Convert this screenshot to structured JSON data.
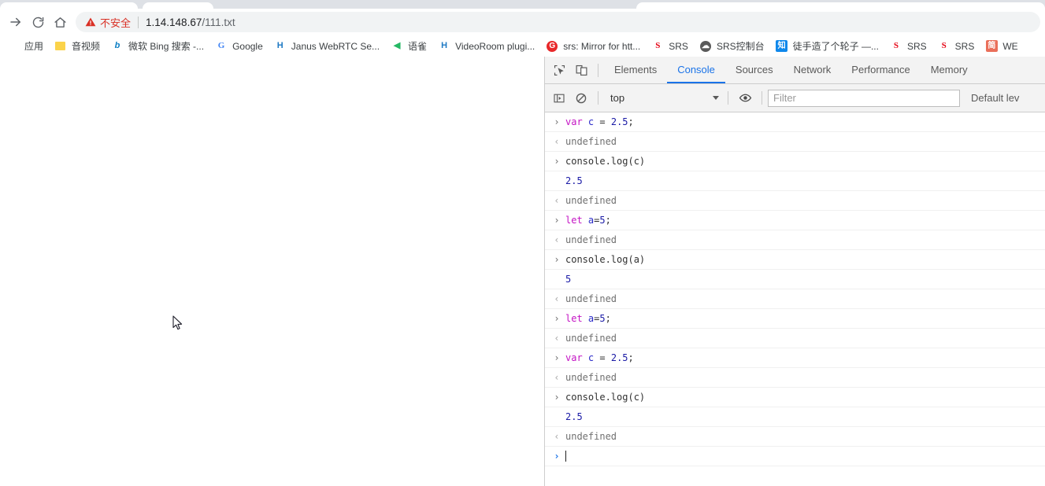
{
  "browser": {
    "nav": {
      "forward_icon": "arrow-right-icon",
      "reload_icon": "reload-icon",
      "home_icon": "home-icon"
    },
    "omnibox": {
      "security_icon": "warning-triangle-icon",
      "security_label": "不安全",
      "url_host": "1.14.148.67",
      "url_path": "/111.txt"
    },
    "bookmarks": [
      {
        "icon": "apps-icon",
        "label": "应用"
      },
      {
        "icon": "folder-icon",
        "label": "音视频"
      },
      {
        "icon": "bing-icon",
        "label": "微软 Bing 搜索 -..."
      },
      {
        "icon": "google-icon",
        "label": "Google"
      },
      {
        "icon": "janus-icon",
        "label": "Janus WebRTC Se..."
      },
      {
        "icon": "yuque-icon",
        "label": "语雀"
      },
      {
        "icon": "janus-icon",
        "label": "VideoRoom plugi..."
      },
      {
        "icon": "srs-github-icon",
        "label": "srs: Mirror for htt..."
      },
      {
        "icon": "srs-icon",
        "label": "SRS"
      },
      {
        "icon": "globe-icon",
        "label": "SRS控制台"
      },
      {
        "icon": "zhihu-icon",
        "label": "徒手造了个轮子 —..."
      },
      {
        "icon": "srs-icon",
        "label": "SRS"
      },
      {
        "icon": "srs-icon",
        "label": "SRS"
      },
      {
        "icon": "jianshu-icon",
        "label": "WE"
      }
    ]
  },
  "devtools": {
    "inspect_icon": "inspect-element-icon",
    "device_icon": "device-toolbar-icon",
    "tabs": [
      {
        "label": "Elements",
        "active": false
      },
      {
        "label": "Console",
        "active": true
      },
      {
        "label": "Sources",
        "active": false
      },
      {
        "label": "Network",
        "active": false
      },
      {
        "label": "Performance",
        "active": false
      },
      {
        "label": "Memory",
        "active": false
      }
    ],
    "toolbar": {
      "sidebar_icon": "console-sidebar-icon",
      "clear_icon": "clear-console-icon",
      "context_value": "top",
      "eye_icon": "live-expression-icon",
      "filter_placeholder": "Filter",
      "filter_value": "",
      "level_label": "Default lev"
    },
    "console_rows": [
      {
        "gutter": "input",
        "kind": "code",
        "tokens": [
          {
            "t": "var",
            "c": "kw"
          },
          {
            "t": " ",
            "c": "op"
          },
          {
            "t": "c",
            "c": "var"
          },
          {
            "t": " = ",
            "c": "op"
          },
          {
            "t": "2.5",
            "c": "num"
          },
          {
            "t": ";",
            "c": "op"
          }
        ]
      },
      {
        "gutter": "output",
        "kind": "undefined",
        "text": "undefined"
      },
      {
        "gutter": "input",
        "kind": "code",
        "tokens": [
          {
            "t": "console.log(c)",
            "c": "op"
          }
        ]
      },
      {
        "gutter": "none",
        "kind": "value",
        "text": "2.5"
      },
      {
        "gutter": "output",
        "kind": "undefined",
        "text": "undefined"
      },
      {
        "gutter": "input",
        "kind": "code",
        "tokens": [
          {
            "t": "let",
            "c": "kw"
          },
          {
            "t": " ",
            "c": "op"
          },
          {
            "t": "a",
            "c": "var"
          },
          {
            "t": "=",
            "c": "op"
          },
          {
            "t": "5",
            "c": "num"
          },
          {
            "t": ";",
            "c": "op"
          }
        ]
      },
      {
        "gutter": "output",
        "kind": "undefined",
        "text": "undefined"
      },
      {
        "gutter": "input",
        "kind": "code",
        "tokens": [
          {
            "t": "console.log(a)",
            "c": "op"
          }
        ]
      },
      {
        "gutter": "none",
        "kind": "value",
        "text": "5"
      },
      {
        "gutter": "output",
        "kind": "undefined",
        "text": "undefined"
      },
      {
        "gutter": "input",
        "kind": "code",
        "tokens": [
          {
            "t": "let",
            "c": "kw"
          },
          {
            "t": " ",
            "c": "op"
          },
          {
            "t": "a",
            "c": "var"
          },
          {
            "t": "=",
            "c": "op"
          },
          {
            "t": "5",
            "c": "num"
          },
          {
            "t": ";",
            "c": "op"
          }
        ]
      },
      {
        "gutter": "output",
        "kind": "undefined",
        "text": "undefined"
      },
      {
        "gutter": "input",
        "kind": "code",
        "tokens": [
          {
            "t": "var",
            "c": "kw"
          },
          {
            "t": " ",
            "c": "op"
          },
          {
            "t": "c",
            "c": "var"
          },
          {
            "t": " = ",
            "c": "op"
          },
          {
            "t": "2.5",
            "c": "num"
          },
          {
            "t": ";",
            "c": "op"
          }
        ]
      },
      {
        "gutter": "output",
        "kind": "undefined",
        "text": "undefined"
      },
      {
        "gutter": "input",
        "kind": "code",
        "tokens": [
          {
            "t": "console.log(c)",
            "c": "op"
          }
        ]
      },
      {
        "gutter": "none",
        "kind": "value",
        "text": "2.5"
      },
      {
        "gutter": "output",
        "kind": "undefined",
        "text": "undefined"
      },
      {
        "gutter": "prompt",
        "kind": "prompt",
        "text": ""
      }
    ]
  },
  "page": {
    "content": "",
    "cursor_icon": "mouse-pointer-icon"
  },
  "colors": {
    "accent": "#1a73e8",
    "insecure": "#d93025",
    "keyword": "#c414c4",
    "number": "#1a1aa6",
    "variable": "#2b2bc8",
    "chrome_bg": "#dee1e6",
    "devtools_bg": "#f3f3f3"
  }
}
